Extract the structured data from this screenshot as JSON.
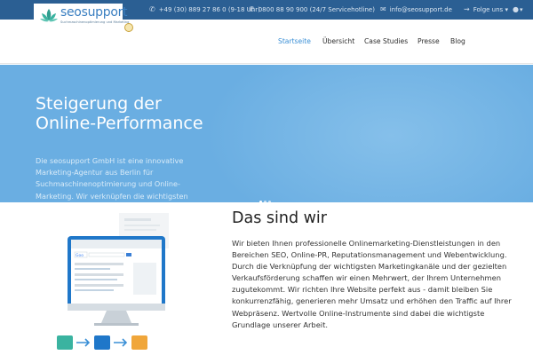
{
  "topbar": {
    "phone": "+49 (30) 889 27 86 0 (9-18 Uhr)",
    "hotline": "0800 88 90 900 (24/7 Servicehotline)",
    "email": "info@seosupport.de",
    "follow": "Folge uns",
    "lang_caret": "▾"
  },
  "logo": {
    "name": "seosupport",
    "tagline": "Suchmaschinenoptimierung und Marketing"
  },
  "nav": {
    "items": [
      {
        "label": "Startseite",
        "active": true
      },
      {
        "label": "Übersicht",
        "active": false
      },
      {
        "label": "Case Studies",
        "active": false
      },
      {
        "label": "Presse",
        "active": false
      },
      {
        "label": "Blog",
        "active": false
      }
    ]
  },
  "hero": {
    "title_line1": "Steigerung der",
    "title_line2": "Online-Performance",
    "description": "Die seosupport GmbH ist eine innovative Marketing-Agentur aus Berlin für Suchmaschinenoptimierung und Online-Marketing. Wir verknüpfen die wichtigsten",
    "slides": 3,
    "active_slide": 1
  },
  "content": {
    "title": "Das sind wir",
    "text": "Wir bieten Ihnen professionelle Onlinemarketing-Dienstleistungen in den Bereichen SEO, Online-PR, Reputationsmanagement und Webentwicklung. Durch die Verknüpfung der wichtigsten Marketingkanäle und der gezielten Verkaufsförderung schaffen wir einen Mehrwert, der Ihrem Unternehmen zugutekommt. Wir richten Ihre Website perfekt aus - damit bleiben Sie konkurrenzfähig, generieren mehr Umsatz und erhöhen den Traffic auf Ihrer Webpräsenz. Wertvolle Online-Instrumente sind dabei die wichtigste Grundlage unserer Arbeit."
  },
  "colors": {
    "topbar": "#2b5f93",
    "hero": "#6aaee2",
    "accent": "#3a8fd6"
  }
}
